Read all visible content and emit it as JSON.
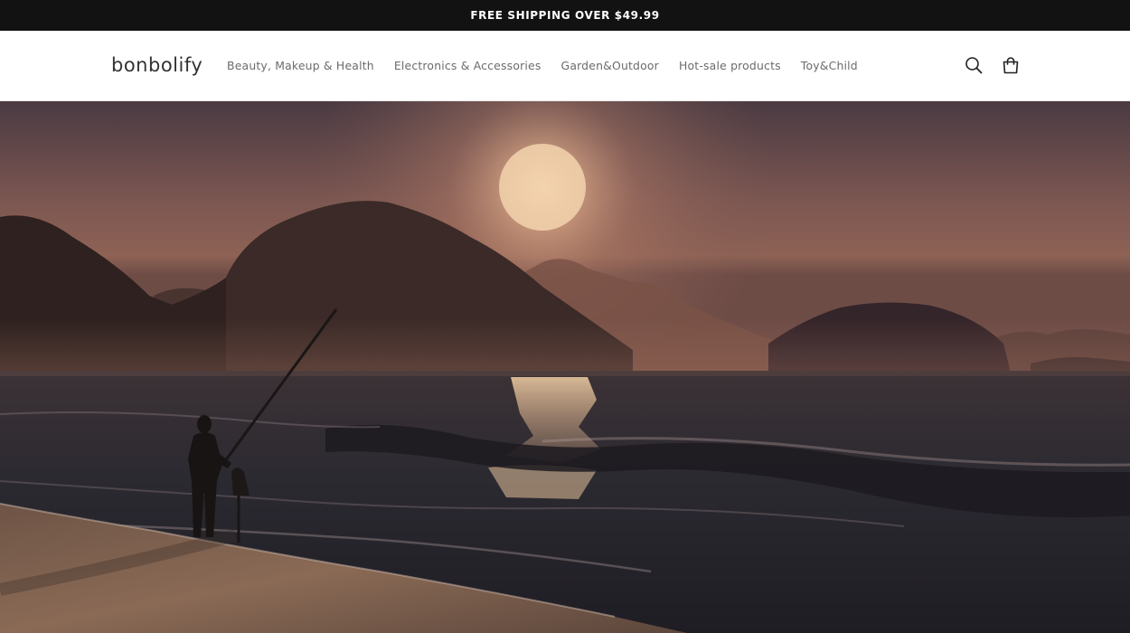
{
  "announcement": {
    "text": "FREE SHIPPING OVER $49.99"
  },
  "header": {
    "logo": "bonbolify",
    "nav": [
      {
        "label": "Beauty, Makeup & Health"
      },
      {
        "label": "Electronics & Accessories"
      },
      {
        "label": "Garden&Outdoor"
      },
      {
        "label": "Hot-sale products"
      },
      {
        "label": "Toy&Child"
      }
    ],
    "icons": {
      "search": "search-icon",
      "cart": "cart-icon"
    }
  },
  "hero": {
    "image": "sunset-beach-fisherman-photo",
    "colors": {
      "sky": "#6b4a48",
      "sun": "#f0c9a0",
      "sea": "#2c2a31",
      "sand": "#8a6a55"
    }
  }
}
